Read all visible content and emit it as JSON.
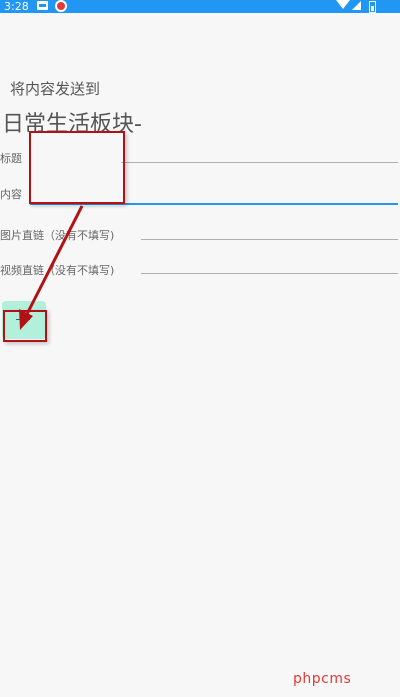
{
  "status_bar": {
    "time": "3:28"
  },
  "form": {
    "send_to_label": "将内容发送到",
    "section_title": "日常生活板块-",
    "fields": {
      "title_label": "标题",
      "content_label": "内容",
      "image_label": "图片直链（没有不填写)",
      "video_label": "视频直链（没有不填写)"
    },
    "submit_button_text": "—"
  },
  "colors": {
    "status_bar": "#2196f3",
    "active_underline": "#2196f3",
    "button_bg": "#b2f0dc",
    "annotation": "#b01216"
  },
  "watermark": "phpcms"
}
